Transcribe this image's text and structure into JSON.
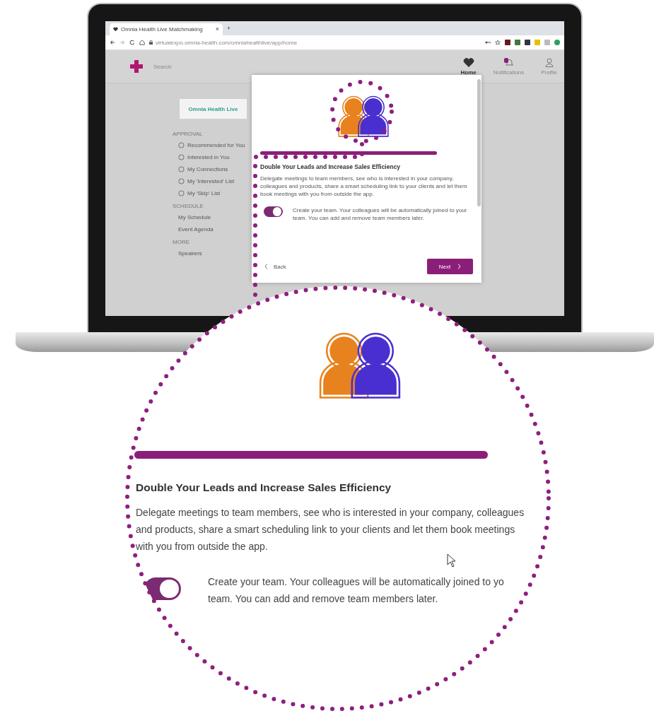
{
  "browser": {
    "tab_title": "Omnia Health Live Matchmaking",
    "tab_close": "×",
    "new_tab": "+",
    "url": "virtualexpo.omnia-health.com/omniahealthlive/app/home"
  },
  "app_header": {
    "search_placeholder": "Search",
    "nav": [
      {
        "label": "Home",
        "selected": true
      },
      {
        "label": "Notifications",
        "selected": false
      },
      {
        "label": "Profile",
        "selected": false
      }
    ]
  },
  "sidebar": {
    "logo_text": "Omnia Health Live",
    "sections": [
      {
        "heading": "APPROVAL",
        "items": [
          "Recommended for You",
          "Interested in You",
          "My Connections",
          "My 'Interested' List",
          "My 'Skip' List"
        ]
      },
      {
        "heading": "SCHEDULE",
        "items": [
          "My Schedule",
          "Event Agenda"
        ]
      },
      {
        "heading": "MORE",
        "items": [
          "Speakers"
        ]
      }
    ]
  },
  "modal": {
    "title": "Double Your Leads and Increase Sales Efficiency",
    "body": "Delegate meetings to team members, see who is interested in your company, colleagues and products, share a smart scheduling link to your clients and let them book meetings with you from outside the app.",
    "toggle": {
      "on": true,
      "label": "Create your team. Your colleagues will be automatically joined to your team. You can add and remove team members later."
    },
    "back": "Back",
    "next": "Next"
  },
  "magnifier": {
    "title": "Double Your Leads and Increase Sales Efficiency",
    "body": "Delegate meetings to team members, see who is interested in your company, colleagues\nand products, share a smart scheduling link to your clients and let them book meetings\nwith you from outside the app.",
    "toggle": {
      "on": true,
      "label": "Create your team. Your colleagues will be automatically joined to yo\nteam. You can add and remove team members later."
    }
  }
}
